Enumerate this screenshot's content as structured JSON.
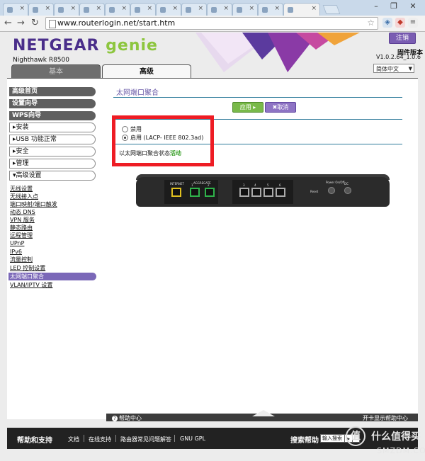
{
  "browser": {
    "url": "www.routerlogin.net/start.htm",
    "window_buttons": {
      "minimize": "–",
      "maximize": "❐",
      "close": "✕"
    }
  },
  "header": {
    "brand": "NETGEAR",
    "product": "genie",
    "model": "Nighthawk R8500",
    "logout_label": "注销",
    "firmware_label": "固件版本",
    "firmware_version": "V1.0.2.64_1.0.6",
    "language": "简体中文",
    "tabs": [
      "基本",
      "高级"
    ]
  },
  "sidebar": {
    "top_items": [
      "高级首页",
      "设置向导",
      "WPS向导"
    ],
    "sections": [
      "▸安装",
      "▸USB 功能正常",
      "▸安全",
      "▸管理",
      "▾高级设置"
    ],
    "sub_items": [
      "无线设置",
      "无线接入点",
      "端口映射/端口触发",
      "动态 DNS",
      "VPN 服务",
      "静态路由",
      "远程管理",
      "UPnP",
      "IPv6",
      "流量控制",
      "LED 控制设置",
      "太网端口聚合",
      "VLAN/IPTV 设置"
    ],
    "active_sub": 11
  },
  "content": {
    "title": "太网端口聚合",
    "apply_label": "应用 ▸",
    "cancel_label": "✖取消",
    "options": [
      {
        "label": "禁用",
        "selected": false
      },
      {
        "label": "启用 (LACP- IEEE 802.3ad)",
        "selected": true
      }
    ],
    "status_label": "以太网端口聚合状态:",
    "status_value": "活动",
    "router_labels": {
      "internet": "INTERNET",
      "aggregate": "AGGREGATE",
      "lan_numbers": [
        "1",
        "2",
        "3",
        "4",
        "5",
        "6"
      ],
      "reset": "Reset",
      "power": "Power On/Off",
      "dc": "DC"
    }
  },
  "footer": {
    "help_center": "帮助中心",
    "help_right": "开卡显示帮助中心",
    "support_title": "帮助和支持",
    "links": [
      "文档",
      "在线支持",
      "路由器常见问题解答",
      "GNU GPL"
    ],
    "search_title": "搜索帮助",
    "search_placeholder": "输入搜索"
  },
  "watermark": {
    "logo_char": "值",
    "text": "什么值得买",
    "sub": "SMZDM.COM"
  },
  "colors": {
    "brand_purple": "#4a2e8a",
    "genie_green": "#8dc63f",
    "highlight_red": "#ee1c24",
    "status_green": "#3aa02a"
  }
}
